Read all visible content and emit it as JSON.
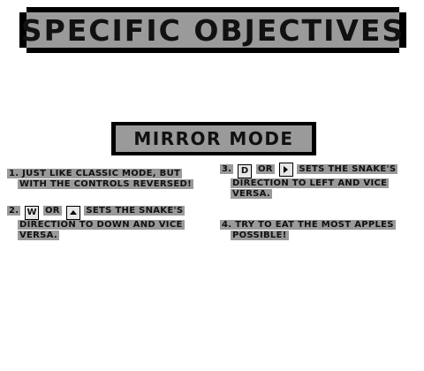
{
  "title": "SPECIFIC OBJECTIVES",
  "mode_title": "MIRROR MODE",
  "objectives": {
    "one": {
      "line1": "1. JUST LIKE CLASSIC MODE, BUT",
      "line2": "WITH THE CONTROLS REVERSED!"
    },
    "two": {
      "prefix": "2.",
      "key": "W",
      "or": "OR",
      "suffix": "SETS THE SNAKE'S",
      "line2": "DIRECTION TO DOWN AND VICE",
      "line3": "VERSA."
    },
    "three": {
      "prefix": "3.",
      "key": "D",
      "or": "OR",
      "suffix": "SETS THE SNAKE'S",
      "line2": "DIRECTION TO LEFT AND VICE",
      "line3": "VERSA."
    },
    "four": {
      "line1": "4. TRY TO EAT THE MOST APPLES",
      "line2": "POSSIBLE!"
    }
  },
  "icons": {
    "up_arrow": "arrow-up-key-icon",
    "right_arrow": "arrow-right-key-icon"
  },
  "colors": {
    "highlight": "#9a9a9a",
    "border": "#000000",
    "background": "#ffffff"
  }
}
